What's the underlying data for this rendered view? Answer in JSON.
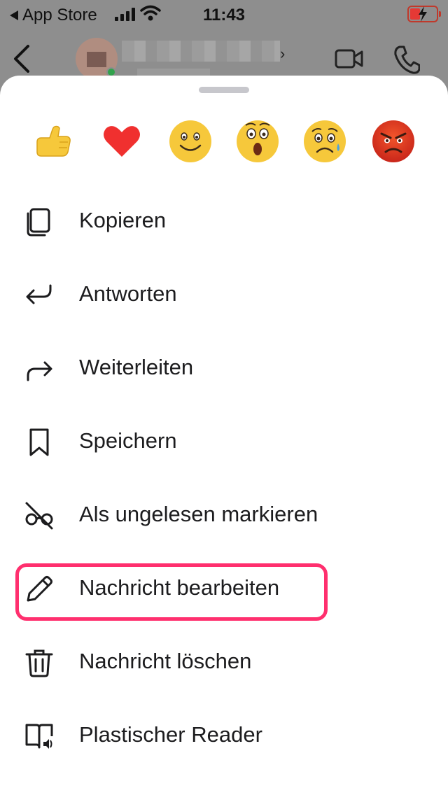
{
  "status_bar": {
    "back_label": "App Store",
    "time": "11:43"
  },
  "chat_header": {
    "contact_name": "",
    "icons": [
      "back-chevron-icon",
      "video-call-icon",
      "phone-call-icon"
    ]
  },
  "reactions": [
    {
      "name": "thumbs-up",
      "emoji": "👍"
    },
    {
      "name": "heart",
      "emoji": "❤"
    },
    {
      "name": "smile",
      "emoji": "🙂"
    },
    {
      "name": "wow",
      "emoji": "😲"
    },
    {
      "name": "sad",
      "emoji": "😢"
    },
    {
      "name": "angry",
      "emoji": "😡"
    }
  ],
  "menu": {
    "items": [
      {
        "label": "Kopieren",
        "icon": "copy-icon"
      },
      {
        "label": "Antworten",
        "icon": "reply-icon"
      },
      {
        "label": "Weiterleiten",
        "icon": "forward-icon"
      },
      {
        "label": "Speichern",
        "icon": "bookmark-icon"
      },
      {
        "label": "Als ungelesen markieren",
        "icon": "unread-glasses-icon"
      },
      {
        "label": "Nachricht bearbeiten",
        "icon": "pencil-icon",
        "highlighted": true
      },
      {
        "label": "Nachricht löschen",
        "icon": "trash-icon"
      },
      {
        "label": "Plastischer Reader",
        "icon": "immersive-reader-icon"
      }
    ]
  },
  "colors": {
    "highlight": "#ff2f6e",
    "dim_overlay": "#8e8e8e",
    "sheet_bg": "#ffffff"
  }
}
